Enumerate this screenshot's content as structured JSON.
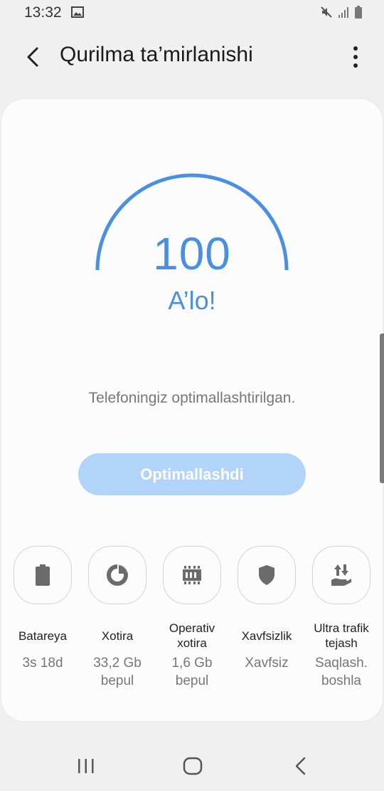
{
  "status_bar": {
    "time": "13:32"
  },
  "app_bar": {
    "title": "Qurilma ta’mirlanishi"
  },
  "score": {
    "value": "100",
    "fraction": 1.0,
    "grade": "A’lo!",
    "color": "#4a90e2"
  },
  "message": "Telefoningiz optimallashtirilgan.",
  "optimize_button": {
    "label": "Optimallashdi"
  },
  "tiles": [
    {
      "label": "Batareya",
      "value": "3s 18d",
      "icon": "battery-icon"
    },
    {
      "label": "Xotira",
      "value": "33,2 Gb\nbepul",
      "icon": "storage-pie-icon"
    },
    {
      "label": "Operativ\nxotira",
      "value": "1,6 Gb\nbepul",
      "icon": "memory-chip-icon"
    },
    {
      "label": "Xavfsizlik",
      "value": "Xavfsiz",
      "icon": "shield-icon"
    },
    {
      "label": "Ultra trafik\ntejash",
      "value": "Saqlash.\nboshla",
      "icon": "data-saver-icon"
    }
  ]
}
